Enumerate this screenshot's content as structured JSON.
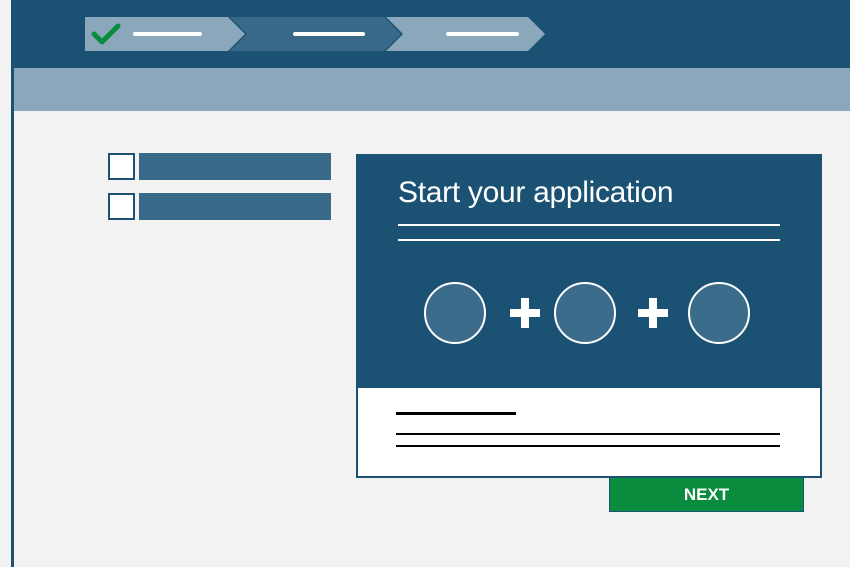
{
  "stepper": {
    "steps": [
      {
        "state": "complete",
        "icon": "checkmark-icon",
        "color": "#8ba7bb"
      },
      {
        "state": "current",
        "color": "#386988"
      },
      {
        "state": "upcoming",
        "color": "#8ba7bb"
      }
    ],
    "check_color": "#0a8c3f"
  },
  "card": {
    "title": "Start your application"
  },
  "next_button": {
    "label": "NEXT",
    "color": "#0a8c3f"
  },
  "colors": {
    "primary": "#1b5173",
    "secondary": "#386988",
    "muted": "#8ba7bb",
    "background": "#f2f2f2"
  }
}
